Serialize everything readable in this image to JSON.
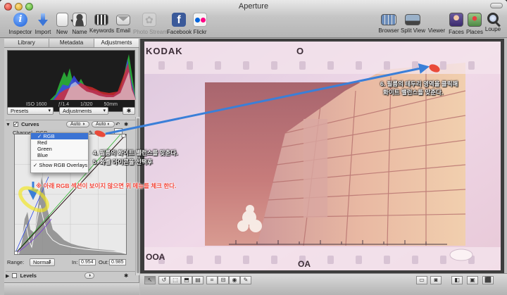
{
  "window": {
    "title": "Aperture"
  },
  "toolbar": {
    "left": [
      {
        "label": "Inspector",
        "icon": "info-icon"
      },
      {
        "label": "Import",
        "icon": "import-arrow-icon"
      },
      {
        "label": "New",
        "icon": "new-item-icon"
      },
      {
        "label": "Name",
        "icon": "name-person-icon"
      },
      {
        "label": "Keywords",
        "icon": "keywords-icon"
      },
      {
        "label": "Email",
        "icon": "email-icon"
      },
      {
        "label": "Photo Stream",
        "icon": "photo-stream-icon",
        "disabled": true
      },
      {
        "label": "Facebook",
        "icon": "facebook-icon"
      },
      {
        "label": "Flickr",
        "icon": "flickr-icon"
      }
    ],
    "right": [
      {
        "label": "Browser",
        "icon": "browser-grid-icon"
      },
      {
        "label": "Split View",
        "icon": "split-view-icon"
      },
      {
        "label": "Viewer",
        "icon": "viewer-icon"
      },
      {
        "label": "Faces",
        "icon": "faces-icon"
      },
      {
        "label": "Places",
        "icon": "places-icon"
      },
      {
        "label": "Loupe",
        "icon": "loupe-icon"
      }
    ],
    "facebook_glyph": "f"
  },
  "inspector": {
    "tabs": [
      "Library",
      "Metadata",
      "Adjustments"
    ],
    "active_tab": "Adjustments",
    "histogram_meta": [
      "ISO 1600",
      "ƒ/1.4",
      "1/320",
      "50mm"
    ],
    "presets_label": "Presets",
    "adjustments_label": "Adjustments",
    "curves": {
      "title": "Curves",
      "auto_left": "Auto",
      "auto_right": "Auto",
      "channel_label": "Channel",
      "channel_value": "RGB"
    },
    "channel_menu": {
      "items": [
        "RGB",
        "Red",
        "Green",
        "Blue"
      ],
      "checked_item": "RGB",
      "overlay_item": "Show RGB Overlays",
      "overlay_checked": true
    },
    "range": {
      "label": "Range:",
      "value": "Normal",
      "in_label": "In:",
      "in_value": "0.954",
      "out_label": "Out:",
      "out_value": "0.985"
    },
    "levels": {
      "title": "Levels"
    }
  },
  "photo": {
    "film_edge_top": "KODAK",
    "film_edge_top2": "O",
    "film_edge_bottom": "OOA",
    "film_edge_bottom2": "OA"
  },
  "annotations": {
    "step6_line1": "6. 필름의 테두리 영역을 클릭해",
    "step6_line2": "화이트 밸런스를 맞춘다.",
    "step4": "4. 필름의 화이트 밸런스를 맞춘다.",
    "step5": "5. 화벨 아이콘을 선택후",
    "warning": "※ 아래 RGB 섹션이 보이지 않으면 위 메뉴를 체크 한다."
  },
  "colors": {
    "accent_blue": "#3b73d4",
    "annotation_arrow": "#3a7fd8",
    "warning_red": "#f2463a",
    "highlight_yellow": "#f3e61a"
  }
}
